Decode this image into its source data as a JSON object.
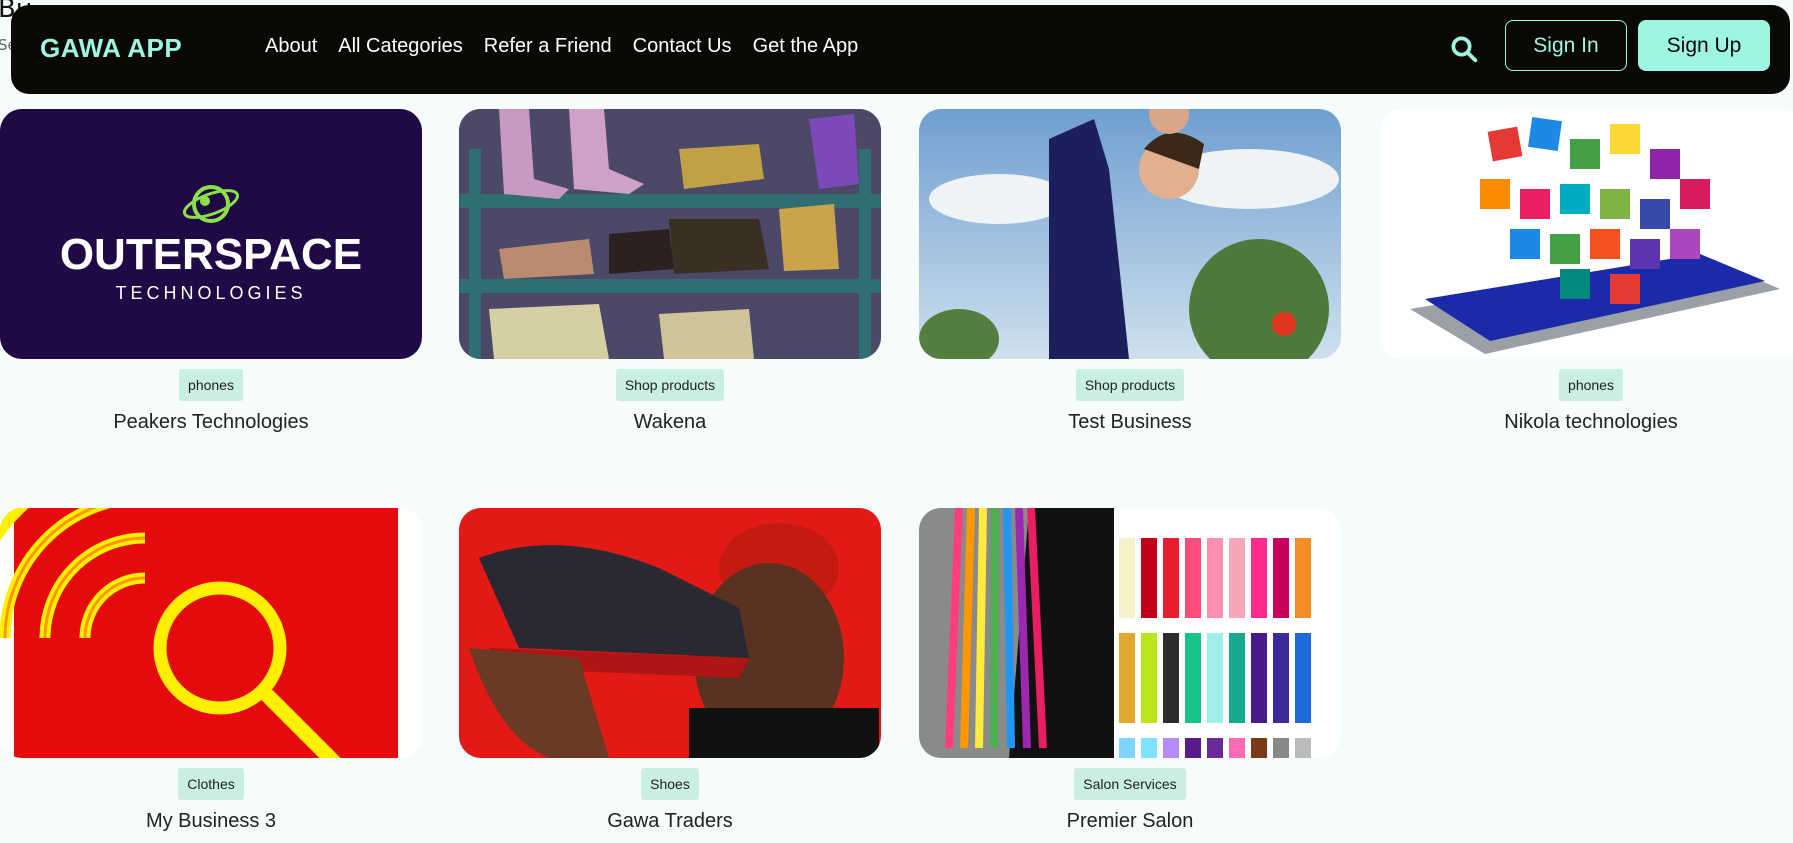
{
  "page": {
    "behind_title": "Bu",
    "behind_subtitle": "Se"
  },
  "nav": {
    "brand": "GAWA APP",
    "links": [
      "About",
      "All Categories",
      "Refer a Friend",
      "Contact Us",
      "Get the App"
    ],
    "search_icon": "search-icon",
    "sign_in": "Sign In",
    "sign_up": "Sign Up"
  },
  "colors": {
    "accent": "#9df5e2",
    "nav_bg": "#0b0905",
    "badge_bg": "#c9efe4",
    "page_bg": "#f5fcfb"
  },
  "businesses": [
    {
      "name": "Peakers Technologies",
      "category": "phones",
      "image": "outerspace-logo",
      "logo_text": "OUTERSPACE",
      "logo_sub": "TECHNOLOGIES"
    },
    {
      "name": "Wakena",
      "category": "Shop products",
      "image": "shoe-shelf-photo"
    },
    {
      "name": "Test Business",
      "category": "Shop products",
      "image": "father-child-photo"
    },
    {
      "name": "Nikola technologies",
      "category": "phones",
      "image": "phone-apps-illustration"
    },
    {
      "name": "My Business 3",
      "category": "Clothes",
      "image": "search-wifi-logo"
    },
    {
      "name": "Gawa Traders",
      "category": "Shoes",
      "image": "sneaker-photo"
    },
    {
      "name": "Premier Salon",
      "category": "Salon Services",
      "image": "braids-photo"
    }
  ]
}
